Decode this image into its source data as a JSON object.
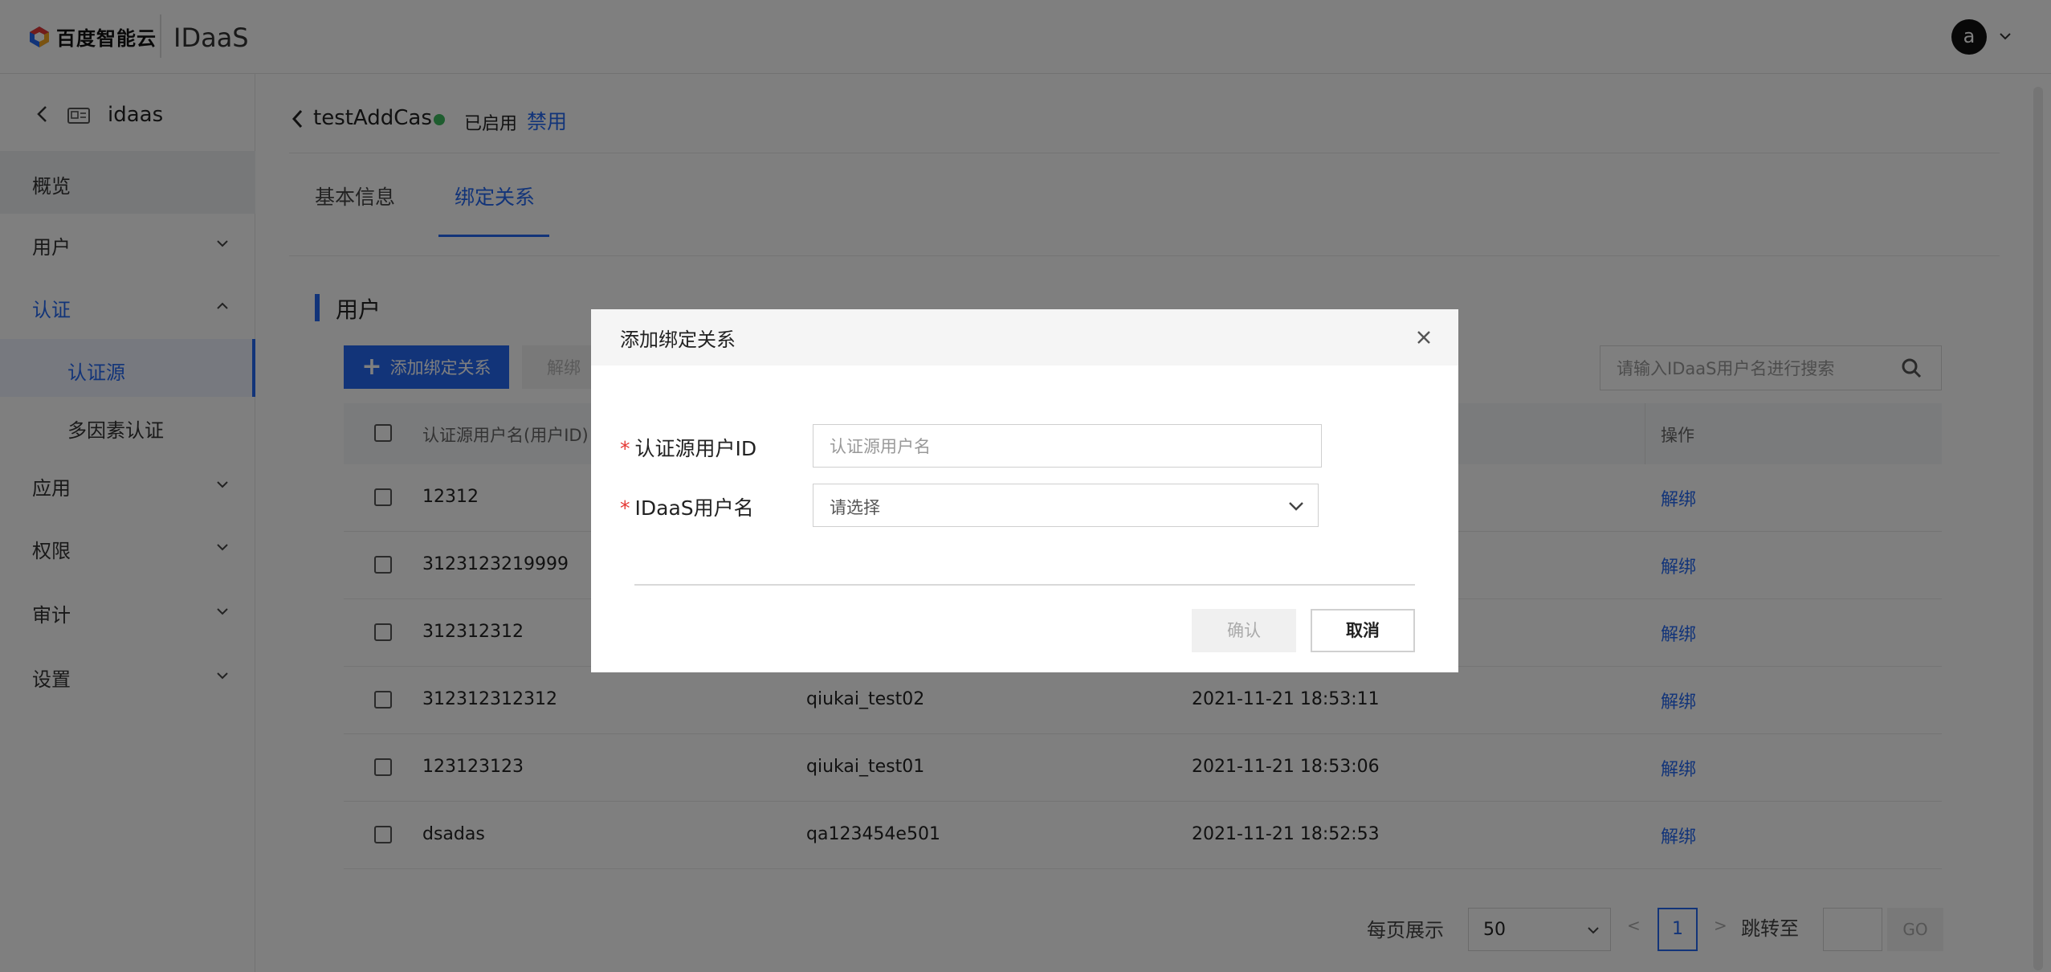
{
  "header": {
    "logo_text": "百度智能云",
    "product_name": "IDaaS",
    "user_avatar": "a"
  },
  "sidebar": {
    "app_name": "idaas",
    "items": [
      {
        "label": "概览"
      },
      {
        "label": "用户"
      },
      {
        "label": "认证"
      },
      {
        "label": "认证源"
      },
      {
        "label": "多因素认证"
      },
      {
        "label": "应用"
      },
      {
        "label": "权限"
      },
      {
        "label": "审计"
      },
      {
        "label": "设置"
      }
    ]
  },
  "page": {
    "title": "testAddCas",
    "status": "已启用",
    "status_color": "#3dba5e",
    "disable_label": "禁用",
    "tabs": [
      {
        "label": "基本信息"
      },
      {
        "label": "绑定关系"
      }
    ],
    "section_title": "用户",
    "add_button": "添加绑定关系",
    "unbind_button": "解绑",
    "search_placeholder": "请输入IDaaS用户名进行搜索"
  },
  "table": {
    "headers": {
      "col1": "认证源用户名(用户ID)",
      "op": "操作"
    },
    "rows": [
      {
        "source_user": "12312",
        "idaas_user": "",
        "time": "",
        "action": "解绑"
      },
      {
        "source_user": "3123123219999",
        "idaas_user": "",
        "time": "",
        "action": "解绑"
      },
      {
        "source_user": "312312312",
        "idaas_user": "",
        "time": "",
        "action": "解绑"
      },
      {
        "source_user": "312312312312",
        "idaas_user": "qiukai_test02",
        "time": "2021-11-21 18:53:11",
        "action": "解绑"
      },
      {
        "source_user": "123123123",
        "idaas_user": "qiukai_test01",
        "time": "2021-11-21 18:53:06",
        "action": "解绑"
      },
      {
        "source_user": "dsadas",
        "idaas_user": "qa123454e501",
        "time": "2021-11-21 18:52:53",
        "action": "解绑"
      }
    ]
  },
  "pagination": {
    "page_size_label": "每页展示",
    "page_size": "50",
    "prev": "<",
    "current_page": "1",
    "next": ">",
    "jump_label": "跳转至",
    "go_label": "GO"
  },
  "modal": {
    "title": "添加绑定关系",
    "required_mark": "*",
    "field1_label": "认证源用户ID",
    "field1_placeholder": "认证源用户名",
    "field2_label": "IDaaS用户名",
    "field2_value": "请选择",
    "confirm_label": "确认",
    "cancel_label": "取消"
  },
  "colors": {
    "accent": "#2468f2",
    "required": "#e53935"
  }
}
